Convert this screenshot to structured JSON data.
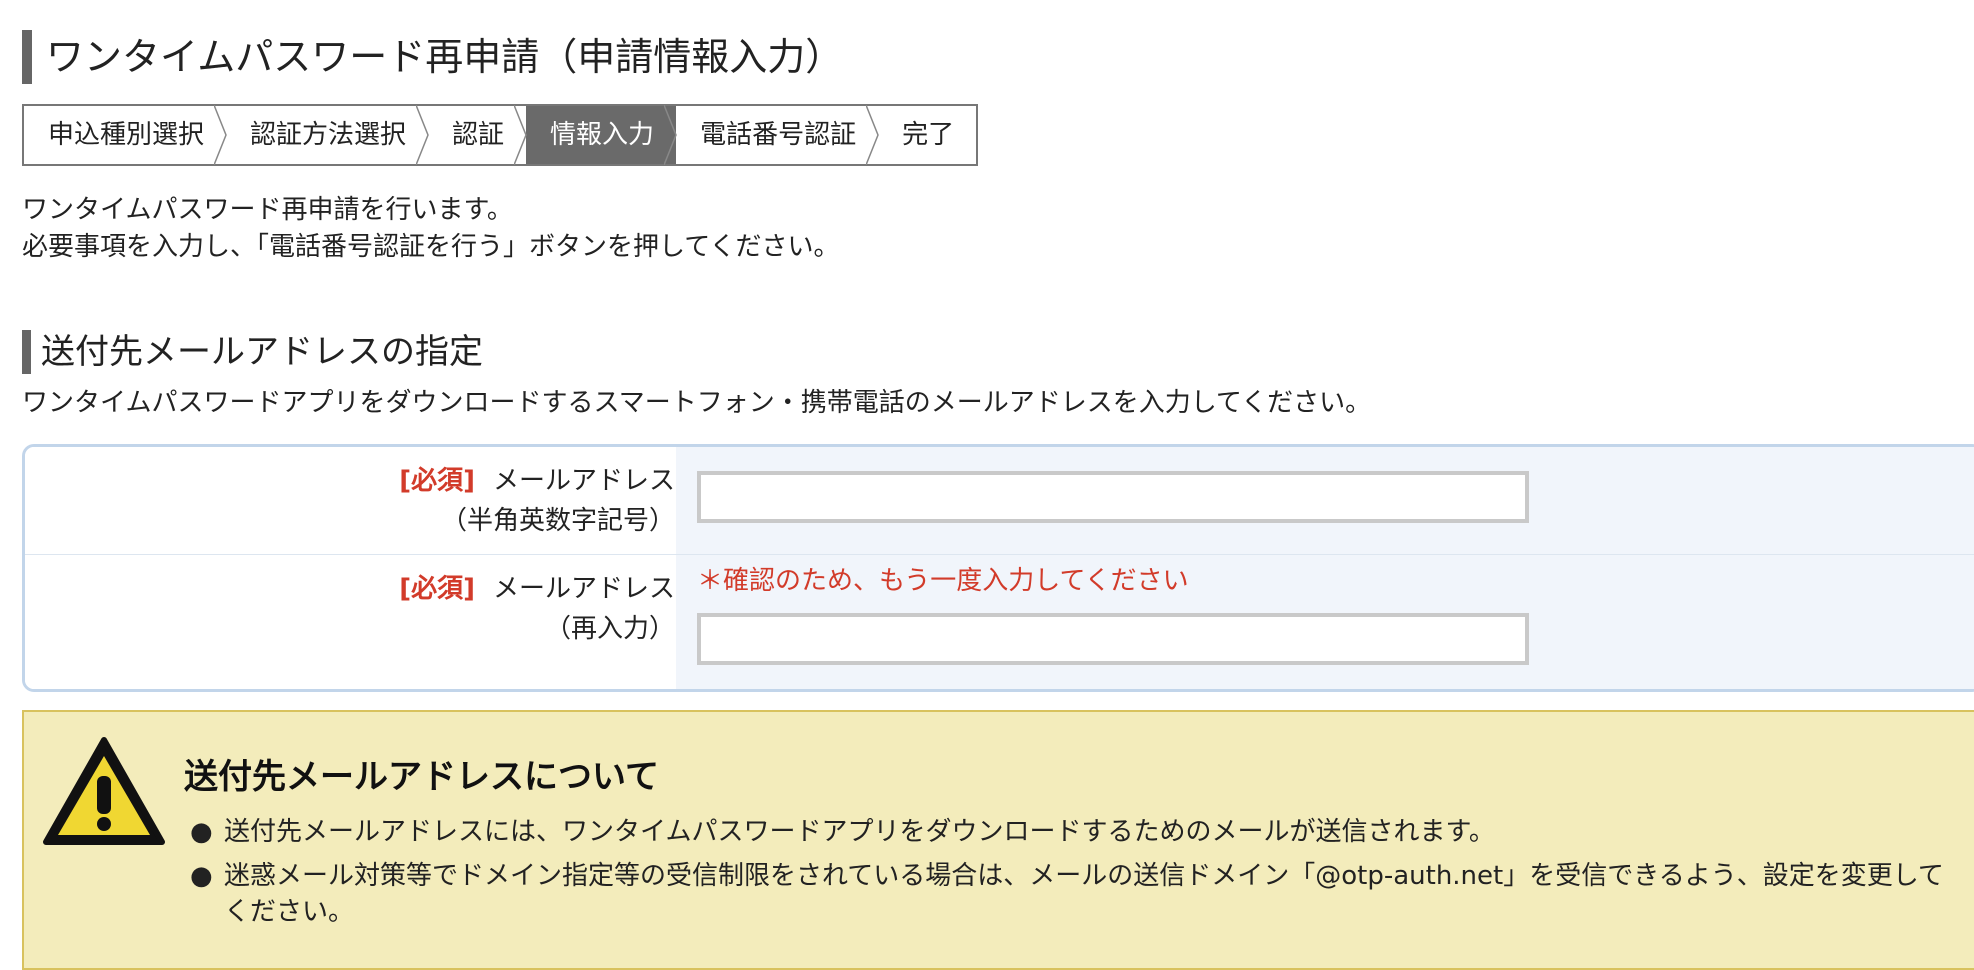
{
  "page_title": "ワンタイムパスワード再申請（申請情報入力）",
  "steps": [
    {
      "label": "申込種別選択",
      "active": false
    },
    {
      "label": "認証方法選択",
      "active": false
    },
    {
      "label": "認証",
      "active": false
    },
    {
      "label": "情報入力",
      "active": true
    },
    {
      "label": "電話番号認証",
      "active": false
    },
    {
      "label": "完了",
      "active": false
    }
  ],
  "intro": {
    "line1": "ワンタイムパスワード再申請を行います。",
    "line2": "必要事項を入力し、「電話番号認証を行う」ボタンを押してください。"
  },
  "section": {
    "title": "送付先メールアドレスの指定",
    "description": "ワンタイムパスワードアプリをダウンロードするスマートフォン・携帯電話のメールアドレスを入力してください。"
  },
  "form": {
    "email": {
      "required_tag": "[必須]",
      "label": "メールアドレス",
      "sublabel": "（半角英数字記号）",
      "value": ""
    },
    "email_confirm": {
      "required_tag": "[必須]",
      "label": "メールアドレス",
      "sublabel": "（再入力）",
      "note": "＊確認のため、もう一度入力してください",
      "value": ""
    }
  },
  "notice": {
    "icon": "warning-icon",
    "title": "送付先メールアドレスについて",
    "bullet": "●",
    "items": [
      "送付先メールアドレスには、ワンタイムパスワードアプリをダウンロードするためのメールが送信されます。",
      "迷惑メール対策等でドメイン指定等の受信制限をされている場合は、メールの送信ドメイン「@otp-auth.net」を受信できるよう、設定を変更してください。"
    ]
  },
  "colors": {
    "accent_gray": "#666666",
    "required_red": "#d23b2a",
    "notice_bg": "#f3ecbb",
    "form_border": "#c2d5ea"
  }
}
